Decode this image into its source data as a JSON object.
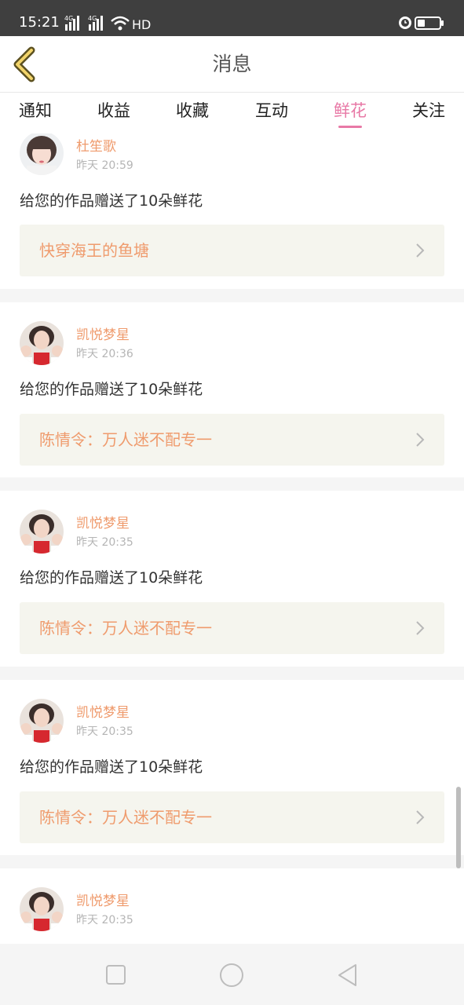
{
  "status_bar": {
    "time": "15:21",
    "signal_labels": [
      "4G",
      "4G"
    ],
    "network": "HD"
  },
  "header": {
    "title": "消息"
  },
  "tabs": [
    {
      "label": "通知",
      "active": false
    },
    {
      "label": "收益",
      "active": false
    },
    {
      "label": "收藏",
      "active": false
    },
    {
      "label": "互动",
      "active": false
    },
    {
      "label": "鲜花",
      "active": true
    },
    {
      "label": "关注",
      "active": false
    }
  ],
  "colors": {
    "accent_pink": "#e879a6",
    "author_orange": "#ef9b6d",
    "link_bg": "#f5f5ee"
  },
  "messages": [
    {
      "author": "杜笙歌",
      "time": "昨天 20:59",
      "text": "给您的作品赠送了10朵鲜花",
      "work": "快穿海王的鱼塘"
    },
    {
      "author": "凯悦梦星",
      "time": "昨天 20:36",
      "text": "给您的作品赠送了10朵鲜花",
      "work": "陈情令：万人迷不配专一"
    },
    {
      "author": "凯悦梦星",
      "time": "昨天 20:35",
      "text": "给您的作品赠送了10朵鲜花",
      "work": "陈情令：万人迷不配专一"
    },
    {
      "author": "凯悦梦星",
      "time": "昨天 20:35",
      "text": "给您的作品赠送了10朵鲜花",
      "work": "陈情令：万人迷不配专一"
    },
    {
      "author": "凯悦梦星",
      "time": "昨天 20:35"
    }
  ]
}
